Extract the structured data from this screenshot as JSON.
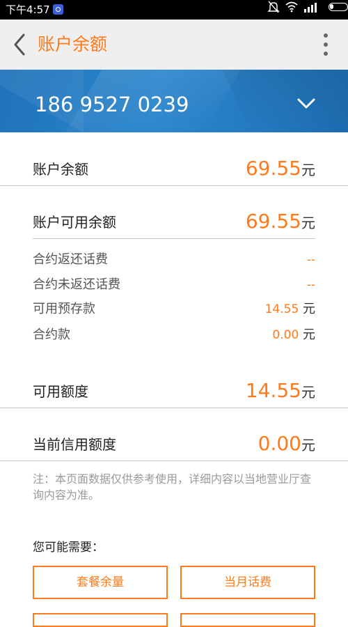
{
  "status_bar": {
    "time": "下午4:57",
    "icons": [
      "app-notification-icon",
      "mute-icon",
      "wifi-icon",
      "signal-icon",
      "battery-icon"
    ]
  },
  "header": {
    "title": "账户余额",
    "back_icon": "chevron-left-icon",
    "menu_icon": "more-vertical-icon"
  },
  "account": {
    "phone_number": "186 9527 0239",
    "dropdown_icon": "chevron-down-icon"
  },
  "balance": {
    "account_balance": {
      "label": "账户余额",
      "value": "69.55",
      "unit": "元"
    },
    "available_balance": {
      "label": "账户可用余额",
      "value": "69.55",
      "unit": "元"
    },
    "details": [
      {
        "label": "合约返还话费",
        "value": "--",
        "unit": ""
      },
      {
        "label": "合约未返还话费",
        "value": "--",
        "unit": ""
      },
      {
        "label": "可用预存款",
        "value": "14.55",
        "unit": " 元"
      },
      {
        "label": "合约款",
        "value": "0.00",
        "unit": " 元"
      }
    ],
    "available_quota": {
      "label": "可用额度",
      "value": "14.55",
      "unit": "元"
    },
    "credit_quota": {
      "label": "当前信用额度",
      "value": "0.00",
      "unit": "元"
    }
  },
  "note": "注：本页面数据仅供参考使用，详细内容以当地营业厅查询内容为准。",
  "suggestions": {
    "title": "您可能需要：",
    "buttons": [
      {
        "label": "套餐余量"
      },
      {
        "label": "当月话费"
      }
    ]
  },
  "colors": {
    "accent": "#ff7a1a",
    "banner": "#2280c6",
    "title_bar": "#efefef",
    "status_bar": "#000000"
  }
}
